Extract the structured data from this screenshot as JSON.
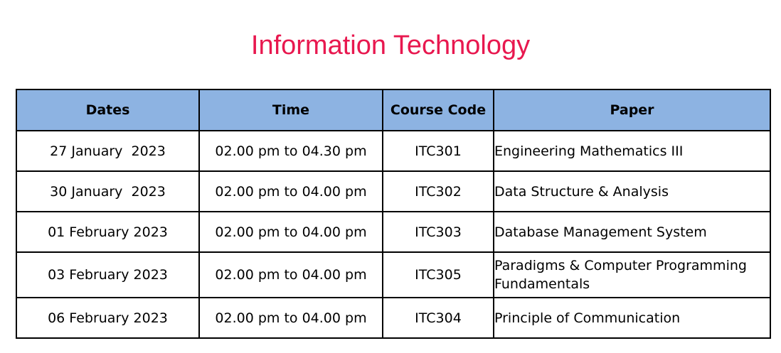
{
  "header": {
    "title": "Information Technology"
  },
  "table": {
    "columns": [
      "Dates",
      "Time",
      "Course Code",
      "Paper"
    ],
    "rows": [
      {
        "date": "27 January  2023",
        "time": "02.00 pm to 04.30 pm",
        "code": "ITC301",
        "paper": "Engineering Mathematics III"
      },
      {
        "date": "30 January  2023",
        "time": "02.00 pm to 04.00 pm",
        "code": "ITC302",
        "paper": "Data Structure & Analysis"
      },
      {
        "date": "01 February 2023",
        "time": "02.00 pm to 04.00 pm",
        "code": "ITC303",
        "paper": "Database Management System"
      },
      {
        "date": "03 February 2023",
        "time": "02.00 pm to 04.00 pm",
        "code": "ITC305",
        "paper": "Paradigms & Computer Programming Fundamentals"
      },
      {
        "date": "06 February 2023",
        "time": "02.00 pm to 04.00 pm",
        "code": "ITC304",
        "paper": "Principle of Communication"
      }
    ]
  },
  "colors": {
    "title": "#e8184f",
    "header_background": "#8db3e2",
    "border": "#000000"
  }
}
